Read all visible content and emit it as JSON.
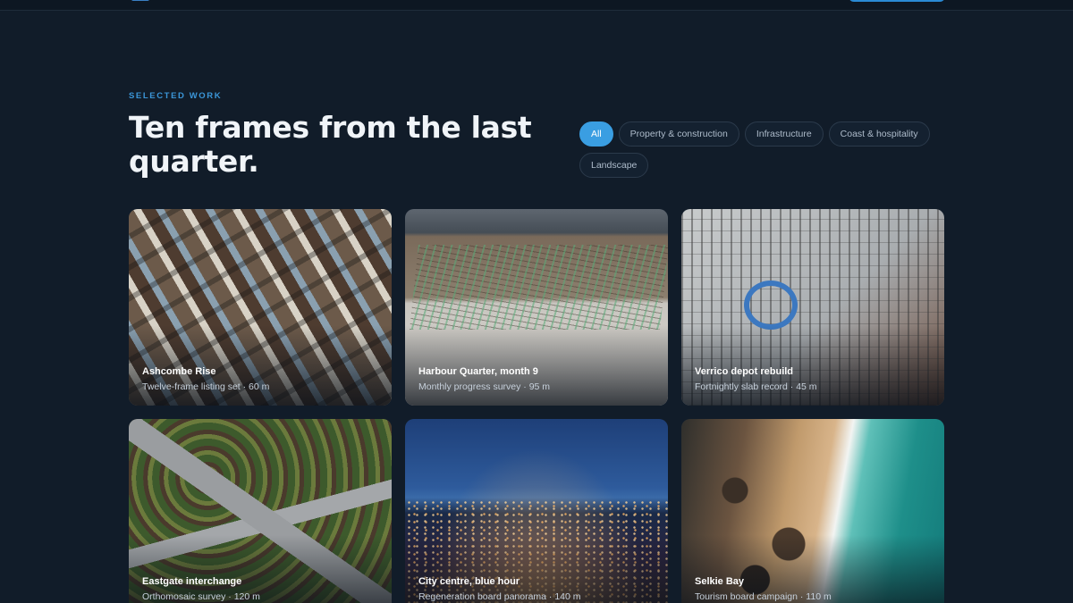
{
  "header": {
    "eyebrow": "SELECTED WORK",
    "headline": "Ten frames from the last quarter."
  },
  "filters": [
    {
      "label": "All",
      "active": true
    },
    {
      "label": "Property & construction",
      "active": false
    },
    {
      "label": "Infrastructure",
      "active": false
    },
    {
      "label": "Coast & hospitality",
      "active": false
    },
    {
      "label": "Landscape",
      "active": false
    }
  ],
  "projects": [
    {
      "title": "Ashcombe Rise",
      "subtitle": "Twelve-frame listing set · 60 m"
    },
    {
      "title": "Harbour Quarter, month 9",
      "subtitle": "Monthly progress survey · 95 m"
    },
    {
      "title": "Verrico depot rebuild",
      "subtitle": "Fortnightly slab record · 45 m"
    },
    {
      "title": "Eastgate interchange",
      "subtitle": "Orthomosaic survey · 120 m"
    },
    {
      "title": "City centre, blue hour",
      "subtitle": "Regeneration board panorama · 140 m"
    },
    {
      "title": "Selkie Bay",
      "subtitle": "Tourism board campaign · 110 m"
    }
  ],
  "colors": {
    "background": "#111c29",
    "accent": "#3a9ee2",
    "eyebrow": "#3b96d8"
  }
}
